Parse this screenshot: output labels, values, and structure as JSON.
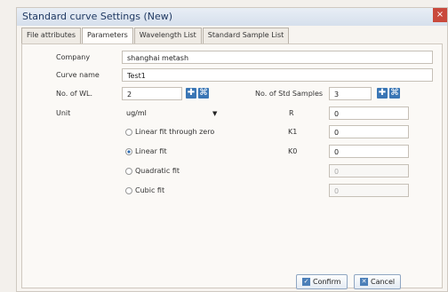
{
  "window": {
    "title": "Standard curve Settings (New)",
    "close_glyph": "×"
  },
  "tabs": [
    {
      "label": "File attributes",
      "active": false
    },
    {
      "label": "Parameters",
      "active": true
    },
    {
      "label": "Wavelength List",
      "active": false
    },
    {
      "label": "Standard Sample List",
      "active": false
    }
  ],
  "form": {
    "company_label": "Company",
    "company_value": "shanghai metash",
    "curve_name_label": "Curve name",
    "curve_name_value": "Test1",
    "no_wl_label": "No. of WL.",
    "no_wl_value": "2",
    "no_std_label": "No. of Std Samples",
    "no_std_value": "3",
    "unit_label": "Unit",
    "unit_value": "ug/ml",
    "unit_chevron": "▼",
    "plus_glyph": "✚",
    "grid_glyph": "⌘",
    "radios": [
      {
        "label": "Linear fit through zero",
        "checked": false
      },
      {
        "label": "Linear fit",
        "checked": true
      },
      {
        "label": "Quadratic fit",
        "checked": false
      },
      {
        "label": "Cubic fit",
        "checked": false
      }
    ],
    "coeffs": [
      {
        "label": "R",
        "value": "0",
        "enabled": true
      },
      {
        "label": "K1",
        "value": "0",
        "enabled": true
      },
      {
        "label": "K0",
        "value": "0",
        "enabled": true
      },
      {
        "label": "",
        "value": "0",
        "enabled": false
      },
      {
        "label": "",
        "value": "0",
        "enabled": false
      }
    ]
  },
  "buttons": {
    "confirm": "Confirm",
    "cancel": "Cancel"
  },
  "colors": {
    "accent": "#2c6bb1",
    "title_text": "#213a63"
  }
}
